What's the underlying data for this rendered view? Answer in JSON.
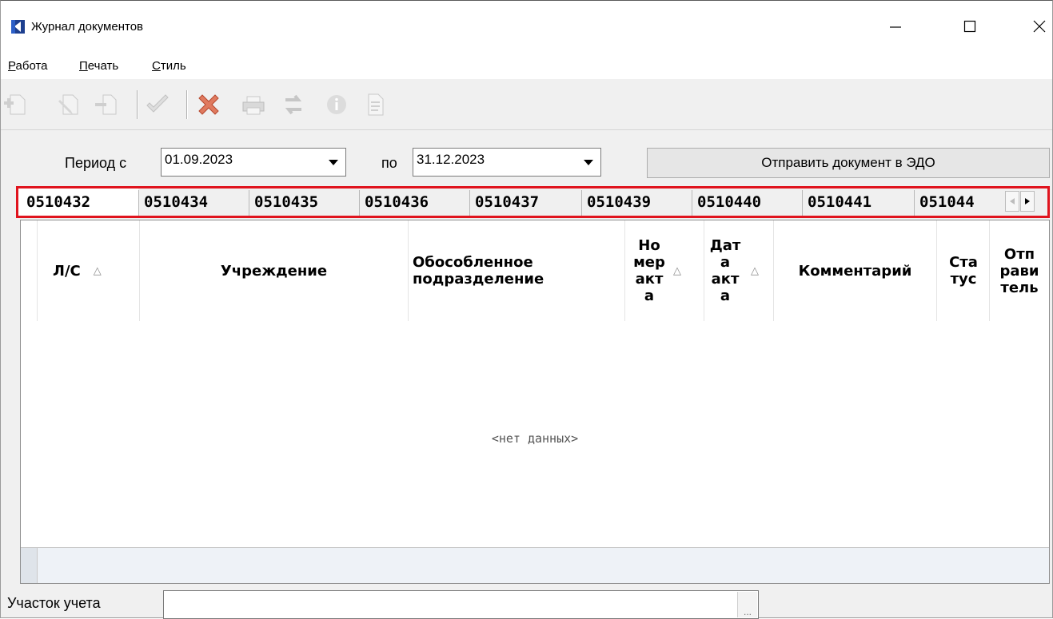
{
  "window": {
    "title": "Журнал документов",
    "controls": {
      "minimize": "–",
      "maximize": "☐",
      "close": "✕"
    }
  },
  "menu": {
    "items": [
      {
        "label": "Работа",
        "accel": "Р",
        "rest": "абота"
      },
      {
        "label": "Печать",
        "accel": "П",
        "rest": "ечать"
      },
      {
        "label": "Стиль",
        "accel": "С",
        "rest": "тиль"
      }
    ]
  },
  "toolbar": {
    "icons": [
      "add-icon",
      "edit-icon",
      "copy-icon",
      "check-icon",
      "delete-icon",
      "print-icon",
      "refresh-icon",
      "info-icon",
      "report-icon"
    ]
  },
  "filter": {
    "period_from_label": "Период с",
    "period_from": "01.09.2023",
    "period_to_label": "по",
    "period_to": "31.12.2023",
    "send_button": "Отправить документ в ЭДО"
  },
  "tabs": [
    "0510432",
    "0510434",
    "0510435",
    "0510436",
    "0510437",
    "0510439",
    "0510440",
    "0510441",
    "051044"
  ],
  "grid": {
    "columns": [
      {
        "label": "Л/С",
        "sortable": true
      },
      {
        "label": "Учреждение",
        "sortable": false
      },
      {
        "label": "Обособленное подразделение",
        "sortable": false
      },
      {
        "label": "Номер акта",
        "sortable": true
      },
      {
        "label": "Дата акта",
        "sortable": true
      },
      {
        "label": "Комментарий",
        "sortable": false
      },
      {
        "label": "Статус",
        "sortable": false
      },
      {
        "label": "Отправитель",
        "sortable": false
      }
    ],
    "header_lines": {
      "ls": "Л/С",
      "uchr": "Учреждение",
      "obos1": "Обособленное",
      "obos2": "подразделение",
      "nomer": [
        "Но",
        "мер",
        "акт",
        "а"
      ],
      "data": [
        "Дат",
        "а",
        "акт",
        "а"
      ],
      "comment": "Комментарий",
      "status": [
        "Ста",
        "тус"
      ],
      "sender": [
        "Отп",
        "рави",
        "тель"
      ]
    },
    "sort_indicator": "△",
    "empty_text": "<нет данных>"
  },
  "footer": {
    "uchastok_label": "Участок учета",
    "uchastok_value": "",
    "ellipsis": "..."
  },
  "colors": {
    "highlight_frame": "#e0141e",
    "delete_icon": "#d9534f",
    "app_icon": "#1d3f8f"
  }
}
